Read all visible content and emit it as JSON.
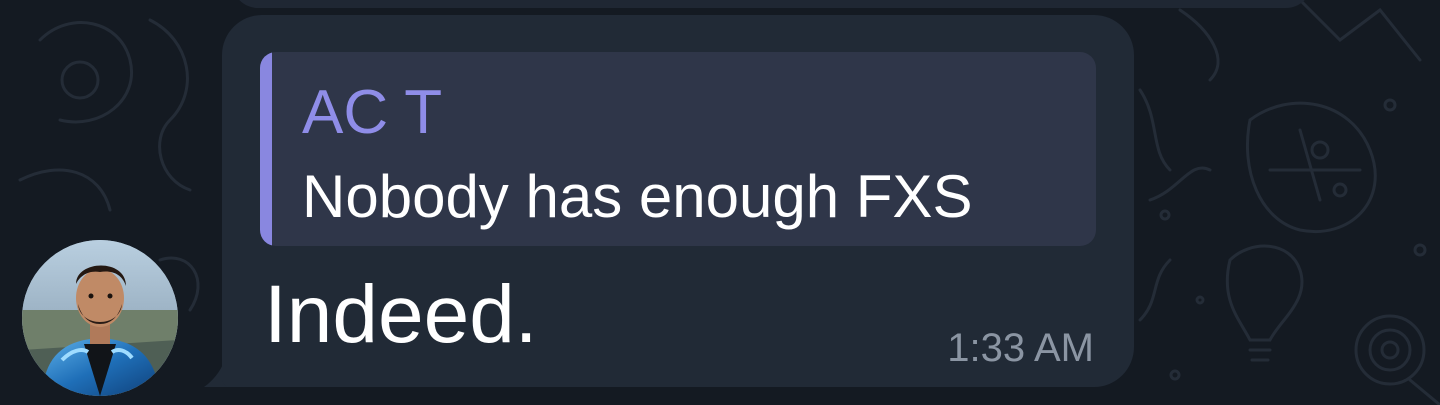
{
  "message": {
    "reply": {
      "author": "AC T",
      "text": "Nobody has enough FXS"
    },
    "text": "Indeed.",
    "time": "1:33 AM"
  },
  "colors": {
    "background": "#141a22",
    "bubble": "#212a36",
    "reply_background": "#2f3649",
    "reply_accent": "#8987e0",
    "text": "#ffffff",
    "timestamp": "#8b95a3"
  }
}
